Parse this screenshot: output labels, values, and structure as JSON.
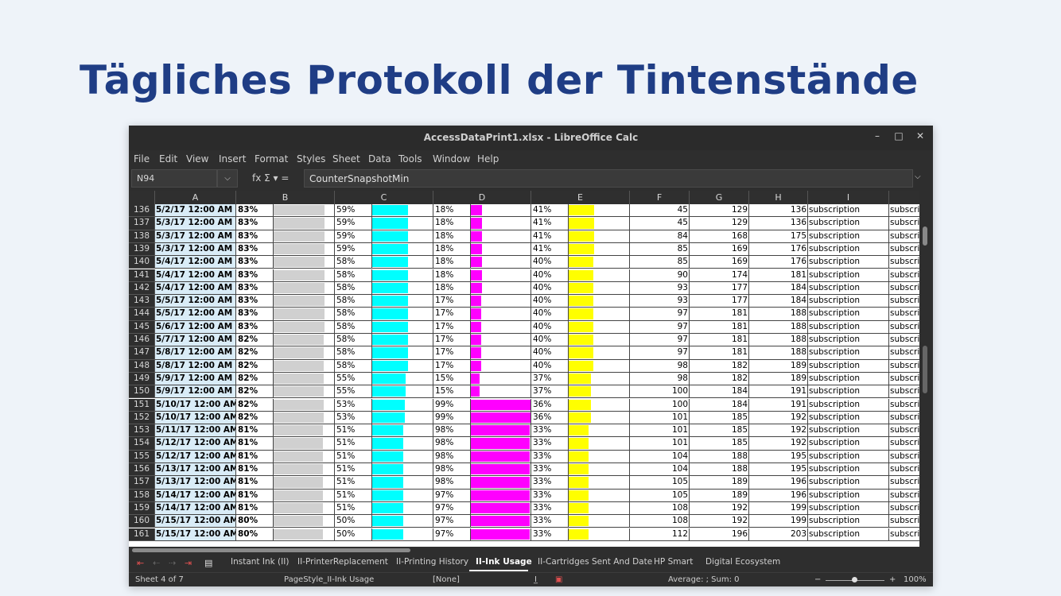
{
  "slide": {
    "title": "Tägliches Protokoll der Tintenstände"
  },
  "window": {
    "title": "AccessDataPrint1.xlsx - LibreOffice Calc",
    "controls": [
      "–",
      "□",
      "✕"
    ]
  },
  "menu": [
    "File",
    "Edit",
    "View",
    "Insert",
    "Format",
    "Styles",
    "Sheet",
    "Data",
    "Tools",
    "Window",
    "Help"
  ],
  "formula_bar": {
    "cell_ref": "N94",
    "icons": "fx  Σ ▾  =",
    "content": "CounterSnapshotMin"
  },
  "columns": [
    "A",
    "B",
    "C",
    "D",
    "E",
    "F",
    "G",
    "H",
    "I",
    ""
  ],
  "colors": {
    "black_bar": "#d0d0d0",
    "cyan": "#00ffff",
    "magenta": "#ff00ff",
    "yellow": "#ffff00",
    "date_bg": "#d9ecf7"
  },
  "rows": [
    {
      "n": "136",
      "date": "5/2/17 12:00 AM",
      "k": "83%",
      "kv": 83,
      "c": "59%",
      "cv": 59,
      "m": "18%",
      "mv": 18,
      "y": "41%",
      "yv": 41,
      "f": "45",
      "g": "129",
      "h": "136",
      "i": "subscription",
      "j": "subscri"
    },
    {
      "n": "137",
      "date": "5/3/17 12:00 AM",
      "k": "83%",
      "kv": 83,
      "c": "59%",
      "cv": 59,
      "m": "18%",
      "mv": 18,
      "y": "41%",
      "yv": 41,
      "f": "45",
      "g": "129",
      "h": "136",
      "i": "subscription",
      "j": "subscri"
    },
    {
      "n": "138",
      "date": "5/3/17 12:00 AM",
      "k": "83%",
      "kv": 83,
      "c": "59%",
      "cv": 59,
      "m": "18%",
      "mv": 18,
      "y": "41%",
      "yv": 41,
      "f": "84",
      "g": "168",
      "h": "175",
      "i": "subscription",
      "j": "subscri"
    },
    {
      "n": "139",
      "date": "5/3/17 12:00 AM",
      "k": "83%",
      "kv": 83,
      "c": "59%",
      "cv": 59,
      "m": "18%",
      "mv": 18,
      "y": "41%",
      "yv": 41,
      "f": "85",
      "g": "169",
      "h": "176",
      "i": "subscription",
      "j": "subscri"
    },
    {
      "n": "140",
      "date": "5/4/17 12:00 AM",
      "k": "83%",
      "kv": 83,
      "c": "58%",
      "cv": 58,
      "m": "18%",
      "mv": 18,
      "y": "40%",
      "yv": 40,
      "f": "85",
      "g": "169",
      "h": "176",
      "i": "subscription",
      "j": "subscri"
    },
    {
      "n": "141",
      "date": "5/4/17 12:00 AM",
      "k": "83%",
      "kv": 83,
      "c": "58%",
      "cv": 58,
      "m": "18%",
      "mv": 18,
      "y": "40%",
      "yv": 40,
      "f": "90",
      "g": "174",
      "h": "181",
      "i": "subscription",
      "j": "subscri"
    },
    {
      "n": "142",
      "date": "5/4/17 12:00 AM",
      "k": "83%",
      "kv": 83,
      "c": "58%",
      "cv": 58,
      "m": "18%",
      "mv": 18,
      "y": "40%",
      "yv": 40,
      "f": "93",
      "g": "177",
      "h": "184",
      "i": "subscription",
      "j": "subscri"
    },
    {
      "n": "143",
      "date": "5/5/17 12:00 AM",
      "k": "83%",
      "kv": 83,
      "c": "58%",
      "cv": 58,
      "m": "17%",
      "mv": 17,
      "y": "40%",
      "yv": 40,
      "f": "93",
      "g": "177",
      "h": "184",
      "i": "subscription",
      "j": "subscri"
    },
    {
      "n": "144",
      "date": "5/5/17 12:00 AM",
      "k": "83%",
      "kv": 83,
      "c": "58%",
      "cv": 58,
      "m": "17%",
      "mv": 17,
      "y": "40%",
      "yv": 40,
      "f": "97",
      "g": "181",
      "h": "188",
      "i": "subscription",
      "j": "subscri"
    },
    {
      "n": "145",
      "date": "5/6/17 12:00 AM",
      "k": "83%",
      "kv": 83,
      "c": "58%",
      "cv": 58,
      "m": "17%",
      "mv": 17,
      "y": "40%",
      "yv": 40,
      "f": "97",
      "g": "181",
      "h": "188",
      "i": "subscription",
      "j": "subscri"
    },
    {
      "n": "146",
      "date": "5/7/17 12:00 AM",
      "k": "82%",
      "kv": 82,
      "c": "58%",
      "cv": 58,
      "m": "17%",
      "mv": 17,
      "y": "40%",
      "yv": 40,
      "f": "97",
      "g": "181",
      "h": "188",
      "i": "subscription",
      "j": "subscri"
    },
    {
      "n": "147",
      "date": "5/8/17 12:00 AM",
      "k": "82%",
      "kv": 82,
      "c": "58%",
      "cv": 58,
      "m": "17%",
      "mv": 17,
      "y": "40%",
      "yv": 40,
      "f": "97",
      "g": "181",
      "h": "188",
      "i": "subscription",
      "j": "subscri"
    },
    {
      "n": "148",
      "date": "5/8/17 12:00 AM",
      "k": "82%",
      "kv": 82,
      "c": "58%",
      "cv": 58,
      "m": "17%",
      "mv": 17,
      "y": "40%",
      "yv": 40,
      "f": "98",
      "g": "182",
      "h": "189",
      "i": "subscription",
      "j": "subscri"
    },
    {
      "n": "149",
      "date": "5/9/17 12:00 AM",
      "k": "82%",
      "kv": 82,
      "c": "55%",
      "cv": 55,
      "m": "15%",
      "mv": 15,
      "y": "37%",
      "yv": 37,
      "f": "98",
      "g": "182",
      "h": "189",
      "i": "subscription",
      "j": "subscri"
    },
    {
      "n": "150",
      "date": "5/9/17 12:00 AM",
      "k": "82%",
      "kv": 82,
      "c": "55%",
      "cv": 55,
      "m": "15%",
      "mv": 15,
      "y": "37%",
      "yv": 37,
      "f": "100",
      "g": "184",
      "h": "191",
      "i": "subscription",
      "j": "subscri"
    },
    {
      "n": "151",
      "date": "5/10/17 12:00 AM",
      "k": "82%",
      "kv": 82,
      "c": "53%",
      "cv": 53,
      "m": "99%",
      "mv": 99,
      "y": "36%",
      "yv": 36,
      "f": "100",
      "g": "184",
      "h": "191",
      "i": "subscription",
      "j": "subscri"
    },
    {
      "n": "152",
      "date": "5/10/17 12:00 AM",
      "k": "82%",
      "kv": 82,
      "c": "53%",
      "cv": 53,
      "m": "99%",
      "mv": 99,
      "y": "36%",
      "yv": 36,
      "f": "101",
      "g": "185",
      "h": "192",
      "i": "subscription",
      "j": "subscri"
    },
    {
      "n": "153",
      "date": "5/11/17 12:00 AM",
      "k": "81%",
      "kv": 81,
      "c": "51%",
      "cv": 51,
      "m": "98%",
      "mv": 98,
      "y": "33%",
      "yv": 33,
      "f": "101",
      "g": "185",
      "h": "192",
      "i": "subscription",
      "j": "subscri"
    },
    {
      "n": "154",
      "date": "5/12/17 12:00 AM",
      "k": "81%",
      "kv": 81,
      "c": "51%",
      "cv": 51,
      "m": "98%",
      "mv": 98,
      "y": "33%",
      "yv": 33,
      "f": "101",
      "g": "185",
      "h": "192",
      "i": "subscription",
      "j": "subscri"
    },
    {
      "n": "155",
      "date": "5/12/17 12:00 AM",
      "k": "81%",
      "kv": 81,
      "c": "51%",
      "cv": 51,
      "m": "98%",
      "mv": 98,
      "y": "33%",
      "yv": 33,
      "f": "104",
      "g": "188",
      "h": "195",
      "i": "subscription",
      "j": "subscri"
    },
    {
      "n": "156",
      "date": "5/13/17 12:00 AM",
      "k": "81%",
      "kv": 81,
      "c": "51%",
      "cv": 51,
      "m": "98%",
      "mv": 98,
      "y": "33%",
      "yv": 33,
      "f": "104",
      "g": "188",
      "h": "195",
      "i": "subscription",
      "j": "subscri"
    },
    {
      "n": "157",
      "date": "5/13/17 12:00 AM",
      "k": "81%",
      "kv": 81,
      "c": "51%",
      "cv": 51,
      "m": "98%",
      "mv": 98,
      "y": "33%",
      "yv": 33,
      "f": "105",
      "g": "189",
      "h": "196",
      "i": "subscription",
      "j": "subscri"
    },
    {
      "n": "158",
      "date": "5/14/17 12:00 AM",
      "k": "81%",
      "kv": 81,
      "c": "51%",
      "cv": 51,
      "m": "97%",
      "mv": 97,
      "y": "33%",
      "yv": 33,
      "f": "105",
      "g": "189",
      "h": "196",
      "i": "subscription",
      "j": "subscri"
    },
    {
      "n": "159",
      "date": "5/14/17 12:00 AM",
      "k": "81%",
      "kv": 81,
      "c": "51%",
      "cv": 51,
      "m": "97%",
      "mv": 97,
      "y": "33%",
      "yv": 33,
      "f": "108",
      "g": "192",
      "h": "199",
      "i": "subscription",
      "j": "subscri"
    },
    {
      "n": "160",
      "date": "5/15/17 12:00 AM",
      "k": "80%",
      "kv": 80,
      "c": "50%",
      "cv": 50,
      "m": "97%",
      "mv": 97,
      "y": "33%",
      "yv": 33,
      "f": "108",
      "g": "192",
      "h": "199",
      "i": "subscription",
      "j": "subscri"
    },
    {
      "n": "161",
      "date": "5/15/17 12:00 AM",
      "k": "80%",
      "kv": 80,
      "c": "50%",
      "cv": 50,
      "m": "97%",
      "mv": 97,
      "y": "33%",
      "yv": 33,
      "f": "112",
      "g": "196",
      "h": "203",
      "i": "subscription",
      "j": "subscri"
    }
  ],
  "sheet_tabs": [
    {
      "label": "Instant Ink (II)",
      "active": false
    },
    {
      "label": "II-PrinterReplacement",
      "active": false
    },
    {
      "label": "II-Printing History",
      "active": false
    },
    {
      "label": "II-Ink Usage",
      "active": true
    },
    {
      "label": "II-Cartridges Sent And Date",
      "active": false
    },
    {
      "label": "HP Smart",
      "active": false
    },
    {
      "label": "Digital Ecosystem",
      "active": false
    }
  ],
  "status": {
    "sheet": "Sheet 4 of 7",
    "page_style": "PageStyle_II-Ink Usage",
    "language": "[None]",
    "summary": "Average: ; Sum: 0",
    "zoom": "100%",
    "zoom_minus": "−",
    "zoom_plus": "+"
  }
}
